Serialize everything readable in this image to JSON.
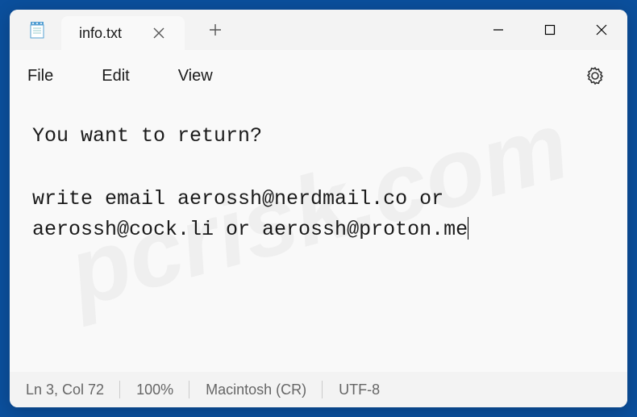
{
  "tab": {
    "title": "info.txt"
  },
  "menu": {
    "file": "File",
    "edit": "Edit",
    "view": "View"
  },
  "content": {
    "line1": "You want to return?",
    "line2": "write email aerossh@nerdmail.co or aerossh@cock.li or aerossh@proton.me"
  },
  "status": {
    "cursor": "Ln 3, Col 72",
    "zoom": "100%",
    "eol": "Macintosh (CR)",
    "encoding": "UTF-8"
  }
}
